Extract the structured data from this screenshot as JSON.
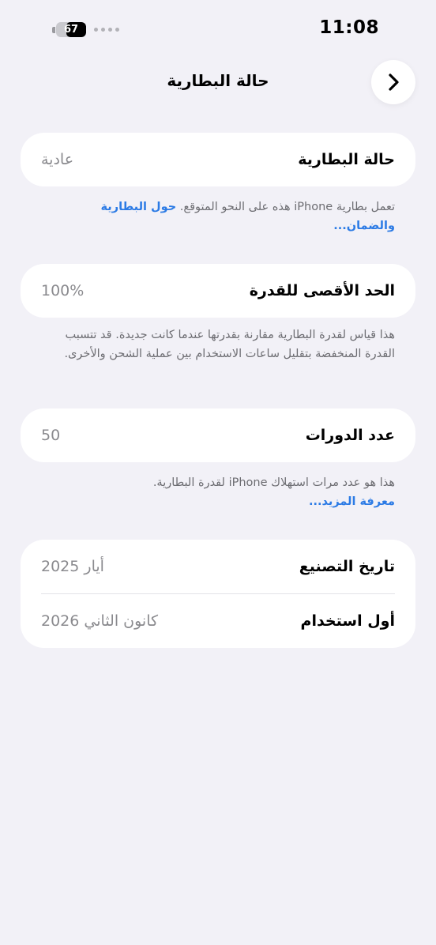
{
  "status_bar": {
    "time": "11:08",
    "battery_level": "67",
    "battery_fraction": 0.67
  },
  "nav": {
    "title": "حالة البطارية",
    "back_icon": "chevron-right-icon"
  },
  "battery_health": {
    "label": "حالة البطارية",
    "value": "عادية",
    "note": "تعمل بطارية iPhone هذه على النحو المتوقع.",
    "link": "حول البطارية والضمان..."
  },
  "max_capacity": {
    "label": "الحد الأقصى للقدرة",
    "value": "100%",
    "note": "هذا قياس لقدرة البطارية مقارنة بقدرتها عندما كانت جديدة. قد تتسبب القدرة المنخفضة بتقليل ساعات الاستخدام بين عملية الشحن والأخرى."
  },
  "cycle_count": {
    "label": "عدد الدورات",
    "value": "50",
    "note": "هذا هو عدد مرات استهلاك iPhone لقدرة البطارية.",
    "link": "معرفة المزيد..."
  },
  "dates": {
    "manufacture_label": "تاريخ التصنيع",
    "manufacture_value": "أيار 2025",
    "first_use_label": "أول استخدام",
    "first_use_value": "كانون الثاني 2026"
  },
  "colors": {
    "background": "#f2f1f7",
    "card": "#ffffff",
    "link": "#2c7be5",
    "secondary_text": "#8a8a8e"
  }
}
